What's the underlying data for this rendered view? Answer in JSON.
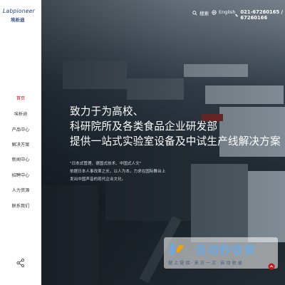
{
  "brand": {
    "logo_en": "Labpioneer",
    "logo_cn": "埃析迪"
  },
  "topbar": {
    "search_label": "搜索",
    "language_label": "English",
    "phone": "021-67260165 / 67260166"
  },
  "sidebar": {
    "items": [
      {
        "label": "首页",
        "active": true
      },
      {
        "label": "埃析迪",
        "active": false
      },
      {
        "label": "产品中心",
        "active": false
      },
      {
        "label": "解决方案",
        "active": false
      },
      {
        "label": "新闻中心",
        "active": false
      },
      {
        "label": "招聘中心",
        "active": false
      },
      {
        "label": "人力资源",
        "active": false
      },
      {
        "label": "联系我们",
        "active": false
      }
    ]
  },
  "hero": {
    "headline_lines": [
      "致力于为高校、",
      "科研院所及各类食品企业研发部",
      "提供一站式实验室设备及中试生产线解决方案"
    ],
    "intro_lines": [
      "\"日本式管理、德国式技术、中国式人文\"",
      "依据日本人事改革之长，以人为本，力求在国际舞台上",
      "发出中国声音的现代企业文化。"
    ]
  },
  "watermark": {
    "title": "自动秒收录",
    "subtitle": "做 上 链 接 · 来 访 一 次 · 自 动 收 录"
  },
  "colors": {
    "accent_red": "#c8161d",
    "logo_blue": "#1d3f8a",
    "sidebar_bg": "#ffffff",
    "headline": "#ffffff"
  }
}
